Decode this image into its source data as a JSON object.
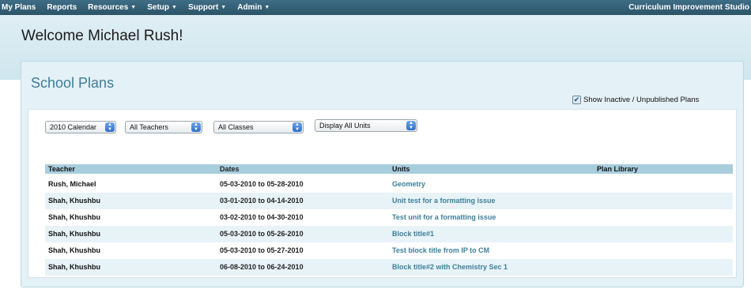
{
  "nav": {
    "items": [
      {
        "label": "My Plans",
        "dropdown": false
      },
      {
        "label": "Reports",
        "dropdown": false
      },
      {
        "label": "Resources",
        "dropdown": true
      },
      {
        "label": "Setup",
        "dropdown": true
      },
      {
        "label": "Support",
        "dropdown": true
      },
      {
        "label": "Admin",
        "dropdown": true
      }
    ],
    "brand": "Curriculum Improvement Studio",
    "caret_glyph": "▼"
  },
  "welcome": "Welcome Michael Rush!",
  "panel": {
    "title": "School Plans"
  },
  "filters": {
    "calendar": "2010 Calendar",
    "teachers": "All Teachers",
    "classes": "All Classes",
    "units": "Display All Units"
  },
  "show_inactive": {
    "label": "Show Inactive / Unpublished Plans",
    "checked": true,
    "check_glyph": "✔"
  },
  "table": {
    "columns": [
      "Teacher",
      "Dates",
      "Units",
      "Plan Library"
    ],
    "rows": [
      {
        "teacher": "Rush, Michael",
        "dates": "05-03-2010 to 05-28-2010",
        "unit": "Geometry",
        "library": ""
      },
      {
        "teacher": "Shah, Khushbu",
        "dates": "03-01-2010 to 04-14-2010",
        "unit": "Unit test for a formatting issue",
        "library": ""
      },
      {
        "teacher": "Shah, Khushbu",
        "dates": "03-02-2010 to 04-30-2010",
        "unit": "Test unit for a formatting issue",
        "library": ""
      },
      {
        "teacher": "Shah, Khushbu",
        "dates": "05-03-2010 to 05-26-2010",
        "unit": "Block title#1",
        "library": ""
      },
      {
        "teacher": "Shah, Khushbu",
        "dates": "05-03-2010 to 05-27-2010",
        "unit": "Test block title from IP to CM",
        "library": ""
      },
      {
        "teacher": "Shah, Khushbu",
        "dates": "06-08-2010 to 06-24-2010",
        "unit": "Block title#2 with Chemistry Sec 1",
        "library": ""
      }
    ]
  },
  "colors": {
    "topbar": "#2f5a6f",
    "header_band": "#d6eaf2",
    "panel_title": "#3f7b98",
    "table_header": "#a8cedd",
    "link": "#3d7f9a"
  }
}
